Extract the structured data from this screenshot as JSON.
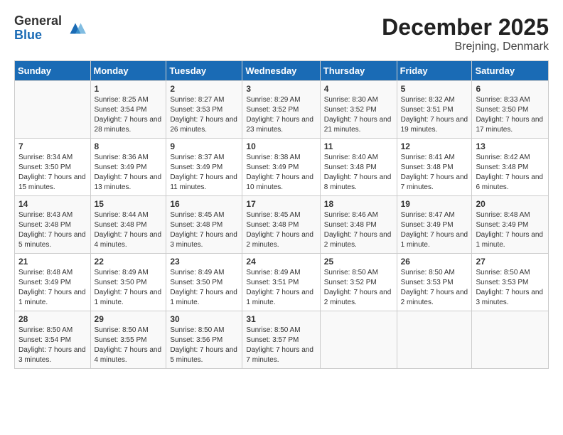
{
  "logo": {
    "general": "General",
    "blue": "Blue"
  },
  "title": "December 2025",
  "location": "Brejning, Denmark",
  "days_header": [
    "Sunday",
    "Monday",
    "Tuesday",
    "Wednesday",
    "Thursday",
    "Friday",
    "Saturday"
  ],
  "weeks": [
    [
      {
        "day": "",
        "content": ""
      },
      {
        "day": "1",
        "content": "Sunrise: 8:25 AM\nSunset: 3:54 PM\nDaylight: 7 hours and 28 minutes."
      },
      {
        "day": "2",
        "content": "Sunrise: 8:27 AM\nSunset: 3:53 PM\nDaylight: 7 hours and 26 minutes."
      },
      {
        "day": "3",
        "content": "Sunrise: 8:29 AM\nSunset: 3:52 PM\nDaylight: 7 hours and 23 minutes."
      },
      {
        "day": "4",
        "content": "Sunrise: 8:30 AM\nSunset: 3:52 PM\nDaylight: 7 hours and 21 minutes."
      },
      {
        "day": "5",
        "content": "Sunrise: 8:32 AM\nSunset: 3:51 PM\nDaylight: 7 hours and 19 minutes."
      },
      {
        "day": "6",
        "content": "Sunrise: 8:33 AM\nSunset: 3:50 PM\nDaylight: 7 hours and 17 minutes."
      }
    ],
    [
      {
        "day": "7",
        "content": "Sunrise: 8:34 AM\nSunset: 3:50 PM\nDaylight: 7 hours and 15 minutes."
      },
      {
        "day": "8",
        "content": "Sunrise: 8:36 AM\nSunset: 3:49 PM\nDaylight: 7 hours and 13 minutes."
      },
      {
        "day": "9",
        "content": "Sunrise: 8:37 AM\nSunset: 3:49 PM\nDaylight: 7 hours and 11 minutes."
      },
      {
        "day": "10",
        "content": "Sunrise: 8:38 AM\nSunset: 3:49 PM\nDaylight: 7 hours and 10 minutes."
      },
      {
        "day": "11",
        "content": "Sunrise: 8:40 AM\nSunset: 3:48 PM\nDaylight: 7 hours and 8 minutes."
      },
      {
        "day": "12",
        "content": "Sunrise: 8:41 AM\nSunset: 3:48 PM\nDaylight: 7 hours and 7 minutes."
      },
      {
        "day": "13",
        "content": "Sunrise: 8:42 AM\nSunset: 3:48 PM\nDaylight: 7 hours and 6 minutes."
      }
    ],
    [
      {
        "day": "14",
        "content": "Sunrise: 8:43 AM\nSunset: 3:48 PM\nDaylight: 7 hours and 5 minutes."
      },
      {
        "day": "15",
        "content": "Sunrise: 8:44 AM\nSunset: 3:48 PM\nDaylight: 7 hours and 4 minutes."
      },
      {
        "day": "16",
        "content": "Sunrise: 8:45 AM\nSunset: 3:48 PM\nDaylight: 7 hours and 3 minutes."
      },
      {
        "day": "17",
        "content": "Sunrise: 8:45 AM\nSunset: 3:48 PM\nDaylight: 7 hours and 2 minutes."
      },
      {
        "day": "18",
        "content": "Sunrise: 8:46 AM\nSunset: 3:48 PM\nDaylight: 7 hours and 2 minutes."
      },
      {
        "day": "19",
        "content": "Sunrise: 8:47 AM\nSunset: 3:49 PM\nDaylight: 7 hours and 1 minute."
      },
      {
        "day": "20",
        "content": "Sunrise: 8:48 AM\nSunset: 3:49 PM\nDaylight: 7 hours and 1 minute."
      }
    ],
    [
      {
        "day": "21",
        "content": "Sunrise: 8:48 AM\nSunset: 3:49 PM\nDaylight: 7 hours and 1 minute."
      },
      {
        "day": "22",
        "content": "Sunrise: 8:49 AM\nSunset: 3:50 PM\nDaylight: 7 hours and 1 minute."
      },
      {
        "day": "23",
        "content": "Sunrise: 8:49 AM\nSunset: 3:50 PM\nDaylight: 7 hours and 1 minute."
      },
      {
        "day": "24",
        "content": "Sunrise: 8:49 AM\nSunset: 3:51 PM\nDaylight: 7 hours and 1 minute."
      },
      {
        "day": "25",
        "content": "Sunrise: 8:50 AM\nSunset: 3:52 PM\nDaylight: 7 hours and 2 minutes."
      },
      {
        "day": "26",
        "content": "Sunrise: 8:50 AM\nSunset: 3:53 PM\nDaylight: 7 hours and 2 minutes."
      },
      {
        "day": "27",
        "content": "Sunrise: 8:50 AM\nSunset: 3:53 PM\nDaylight: 7 hours and 3 minutes."
      }
    ],
    [
      {
        "day": "28",
        "content": "Sunrise: 8:50 AM\nSunset: 3:54 PM\nDaylight: 7 hours and 3 minutes."
      },
      {
        "day": "29",
        "content": "Sunrise: 8:50 AM\nSunset: 3:55 PM\nDaylight: 7 hours and 4 minutes."
      },
      {
        "day": "30",
        "content": "Sunrise: 8:50 AM\nSunset: 3:56 PM\nDaylight: 7 hours and 5 minutes."
      },
      {
        "day": "31",
        "content": "Sunrise: 8:50 AM\nSunset: 3:57 PM\nDaylight: 7 hours and 7 minutes."
      },
      {
        "day": "",
        "content": ""
      },
      {
        "day": "",
        "content": ""
      },
      {
        "day": "",
        "content": ""
      }
    ]
  ]
}
